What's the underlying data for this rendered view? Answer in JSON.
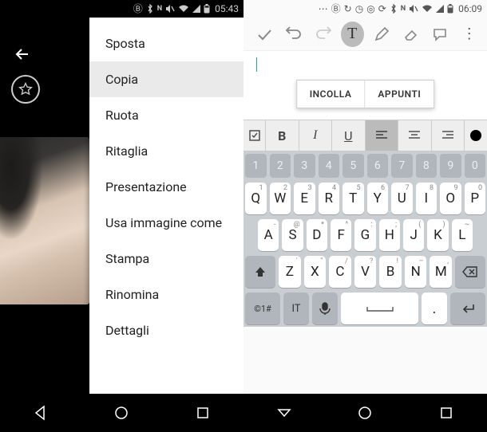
{
  "left": {
    "status_time": "05:43",
    "menu": {
      "items": [
        {
          "label": "Sposta"
        },
        {
          "label": "Copia",
          "selected": true
        },
        {
          "label": "Ruota"
        },
        {
          "label": "Ritaglia"
        },
        {
          "label": "Presentazione"
        },
        {
          "label": "Usa immagine come"
        },
        {
          "label": "Stampa"
        },
        {
          "label": "Rinomina"
        },
        {
          "label": "Dettagli"
        }
      ]
    }
  },
  "right": {
    "status_time": "06:09",
    "toolbar": {
      "text_tool": "T"
    },
    "paste": {
      "incolla": "INCOLLA",
      "appunti": "APPUNTI"
    },
    "format": {
      "bold": "B",
      "italic": "I",
      "underline": "U"
    },
    "keyboard": {
      "nums": [
        "1",
        "2",
        "3",
        "4",
        "5",
        "6",
        "7",
        "8",
        "9",
        "0"
      ],
      "row1": [
        {
          "k": "Q",
          "s": "1"
        },
        {
          "k": "W",
          "s": "2"
        },
        {
          "k": "E",
          "s": "3"
        },
        {
          "k": "R",
          "s": "4"
        },
        {
          "k": "T",
          "s": "5"
        },
        {
          "k": "Y",
          "s": "6"
        },
        {
          "k": "U",
          "s": "7"
        },
        {
          "k": "I",
          "s": "8"
        },
        {
          "k": "O",
          "s": "9"
        },
        {
          "k": "P",
          "s": "0"
        }
      ],
      "row2": [
        {
          "k": "A",
          "s": "-"
        },
        {
          "k": "S",
          "s": "@"
        },
        {
          "k": "D",
          "s": "*"
        },
        {
          "k": "F",
          "s": "^"
        },
        {
          "k": "G",
          "s": ":"
        },
        {
          "k": "H",
          "s": ";"
        },
        {
          "k": "J",
          "s": "("
        },
        {
          "k": "K",
          "s": ")"
        },
        {
          "k": "L",
          "s": "~"
        }
      ],
      "row3": [
        {
          "k": "Z",
          "s": "'"
        },
        {
          "k": "X",
          "s": "\""
        },
        {
          "k": "C",
          "s": "/"
        },
        {
          "k": "V",
          "s": "?"
        },
        {
          "k": "B",
          "s": "!"
        },
        {
          "k": "N",
          "s": "–"
        },
        {
          "k": "M",
          "s": ","
        }
      ],
      "sym": "©1#",
      "lang": "IT",
      "period": "."
    }
  }
}
